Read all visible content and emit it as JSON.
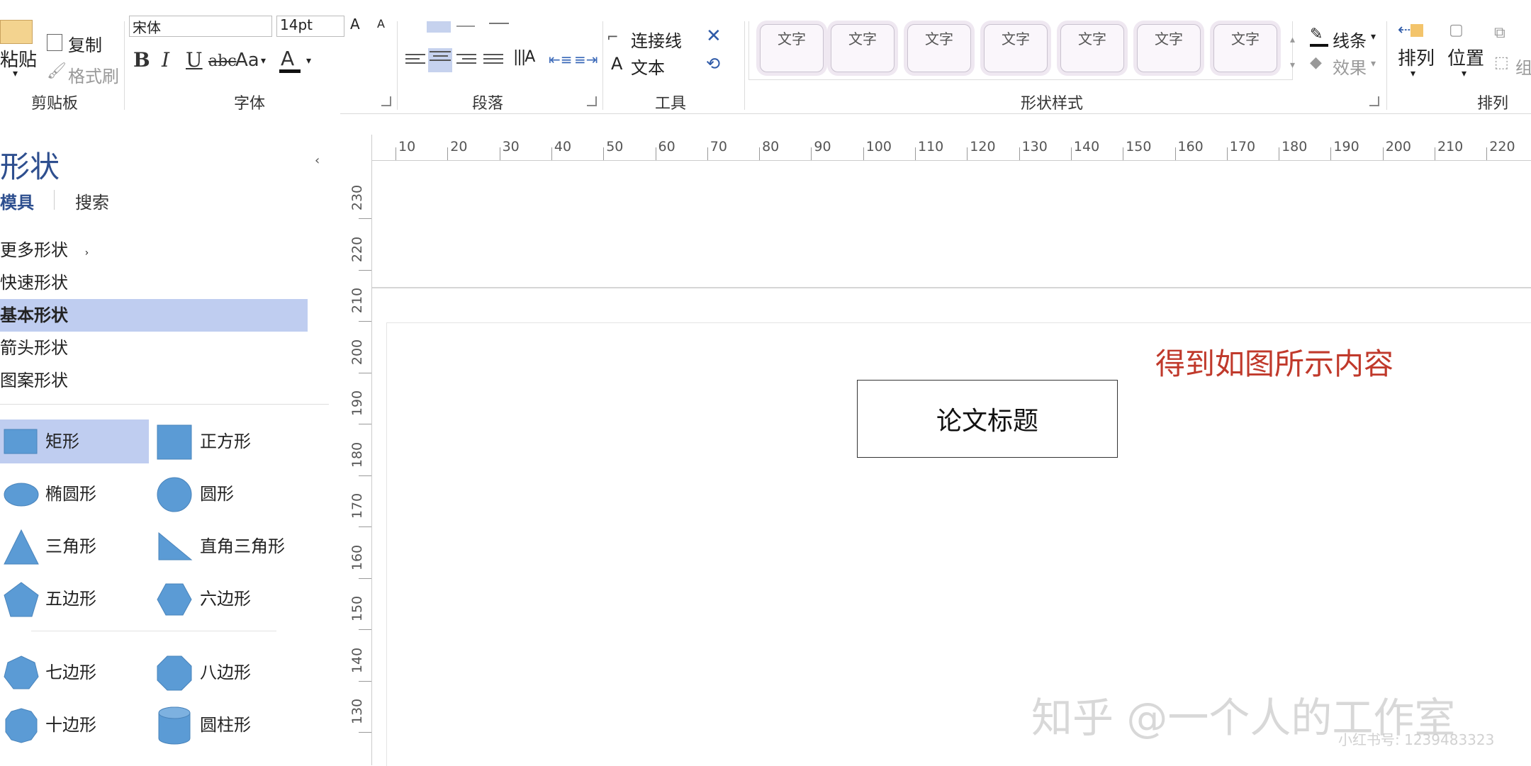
{
  "ribbon": {
    "clipboard": {
      "paste": "粘贴",
      "copy": "复制",
      "format_painter": "格式刷",
      "group_label": "剪贴板"
    },
    "font": {
      "font_name": "宋体",
      "font_size": "14pt",
      "bold": "B",
      "italic": "I",
      "underline": "U",
      "strikethrough": "abc",
      "change_case": "Aa",
      "font_color": "A",
      "group_label": "字体"
    },
    "paragraph": {
      "group_label": "段落"
    },
    "tools": {
      "connector": "连接线",
      "text": "文本",
      "text_icon": "A",
      "group_label": "工具"
    },
    "shape_styles": {
      "items": [
        "文字",
        "文字",
        "文字",
        "文字",
        "文字",
        "文字",
        "文字"
      ],
      "line": "线条",
      "effects": "效果",
      "group_label": "形状样式"
    },
    "arrange": {
      "arrange": "排列",
      "position": "位置",
      "group": "组",
      "group_label": "排列"
    }
  },
  "panel": {
    "title": "形状",
    "tabs": [
      "模具",
      "搜索"
    ],
    "categories": [
      "更多形状",
      "快速形状",
      "基本形状",
      "箭头形状",
      "图案形状"
    ],
    "selected_category": "基本形状",
    "shapes": [
      "矩形",
      "正方形",
      "椭圆形",
      "圆形",
      "三角形",
      "直角三角形",
      "五边形",
      "六边形",
      "七边形",
      "八边形",
      "十边形",
      "圆柱形"
    ]
  },
  "ruler_top": [
    "10",
    "20",
    "30",
    "40",
    "50",
    "60",
    "70",
    "80",
    "90",
    "100",
    "110",
    "120",
    "130",
    "140",
    "150",
    "160",
    "170",
    "180",
    "190",
    "200",
    "210",
    "220"
  ],
  "ruler_left": [
    "230",
    "220",
    "210",
    "200",
    "190",
    "180",
    "170",
    "160",
    "150",
    "140",
    "130"
  ],
  "canvas": {
    "box_text": "论文标题",
    "annotation": "得到如图所示内容",
    "watermark": "知乎 @一个人的工作室",
    "watermark_small": "小红书号: 1239483323"
  },
  "colors": {
    "shape_fill": "#5b9bd5",
    "selection": "#bfcdf0",
    "annotation": "#c0392b",
    "accent": "#2e4f8f"
  }
}
